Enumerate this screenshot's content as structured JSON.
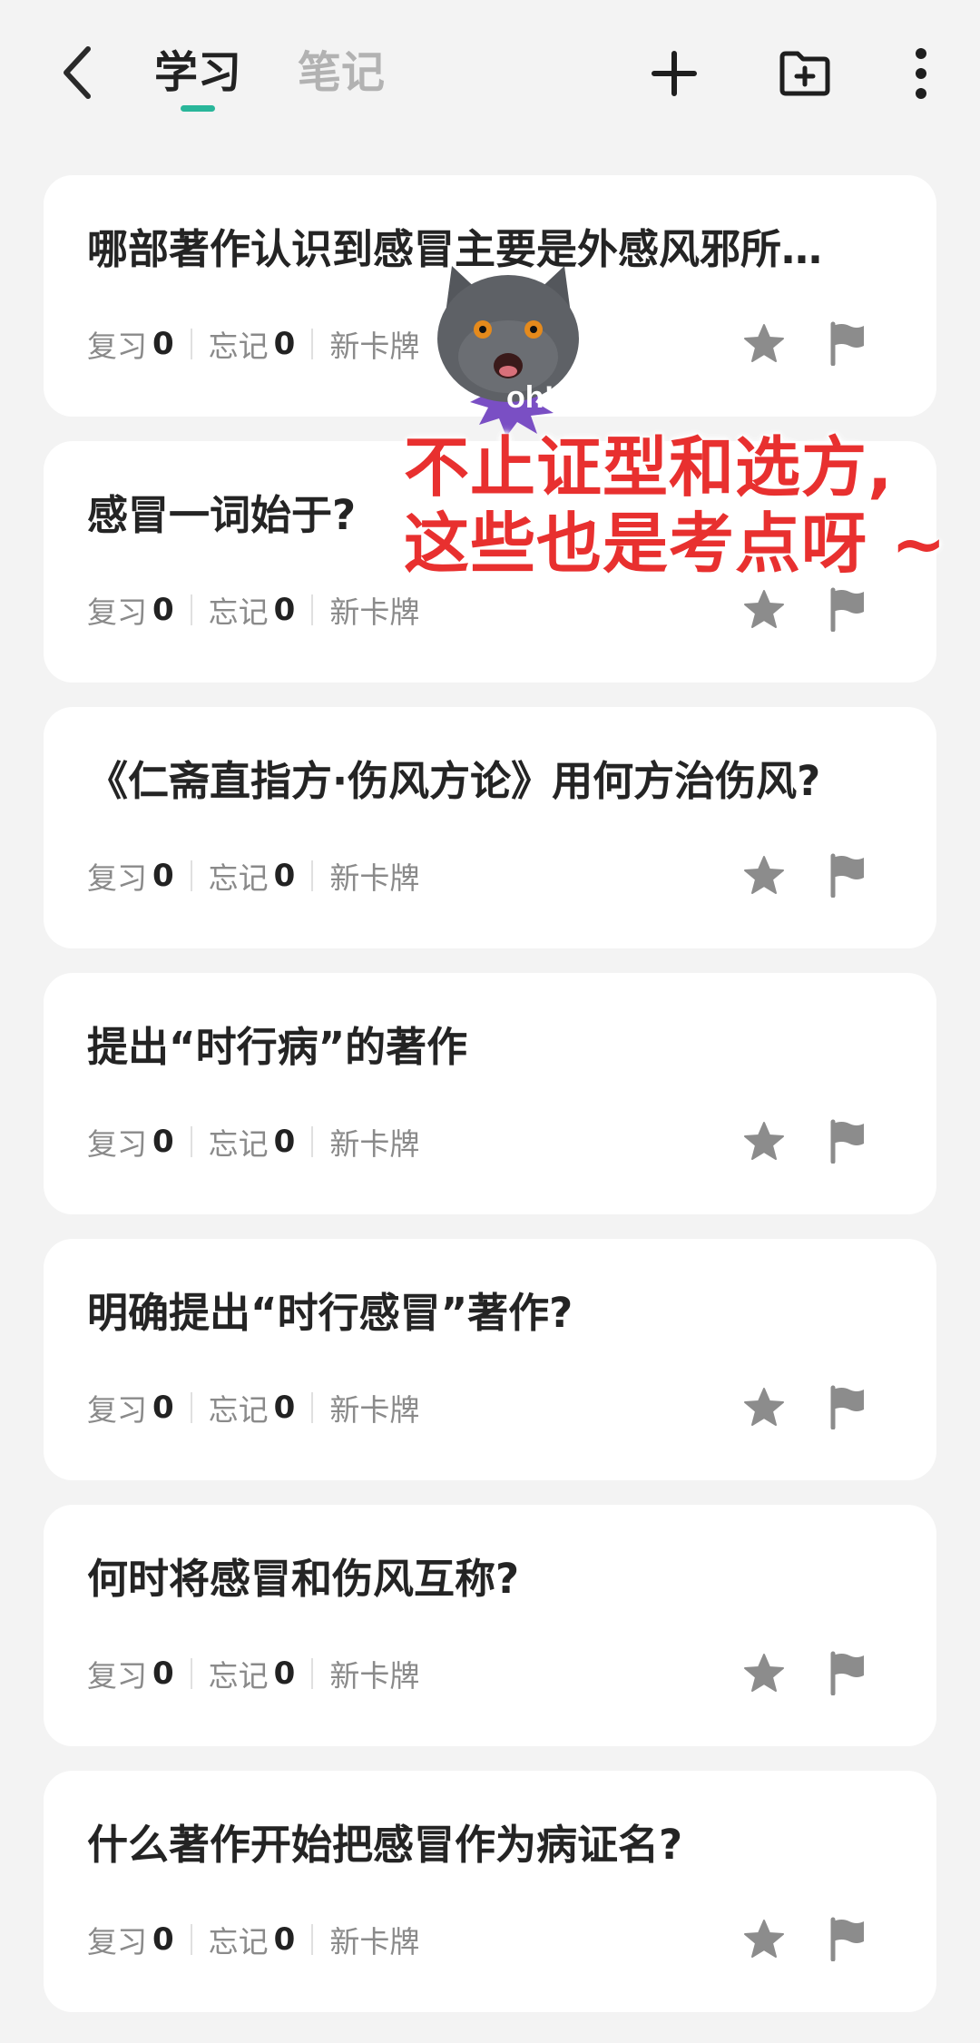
{
  "header": {
    "tabs": [
      {
        "label": "学习",
        "active": true
      },
      {
        "label": "笔记",
        "active": false
      }
    ],
    "icons": [
      "chevron-left-icon",
      "plus-icon",
      "folder-add-icon",
      "more-vertical-icon"
    ],
    "accent_color": "#29b69a"
  },
  "card_meta_labels": {
    "review": "复习",
    "forget": "忘记",
    "new": "新卡牌"
  },
  "cards": [
    {
      "question": "哪部著作认识到感冒主要是外感风邪所…",
      "review": "0",
      "forget": "0"
    },
    {
      "question": "感冒一词始于?",
      "review": "0",
      "forget": "0"
    },
    {
      "question": "《仁斋直指方·伤风方论》用何方治伤风?",
      "review": "0",
      "forget": "0"
    },
    {
      "question": "提出“时行病”的著作",
      "review": "0",
      "forget": "0"
    },
    {
      "question": "明确提出“时行感冒”著作?",
      "review": "0",
      "forget": "0"
    },
    {
      "question": "何时将感冒和伤风互称?",
      "review": "0",
      "forget": "0"
    },
    {
      "question": "什么著作开始把感冒作为病证名?",
      "review": "0",
      "forget": "0"
    }
  ],
  "sticker": {
    "badge_text": "oh!",
    "caption_line1": "不止证型和选方,",
    "caption_line2": "这些也是考点呀 ~",
    "caption_color": "#e8302f"
  }
}
